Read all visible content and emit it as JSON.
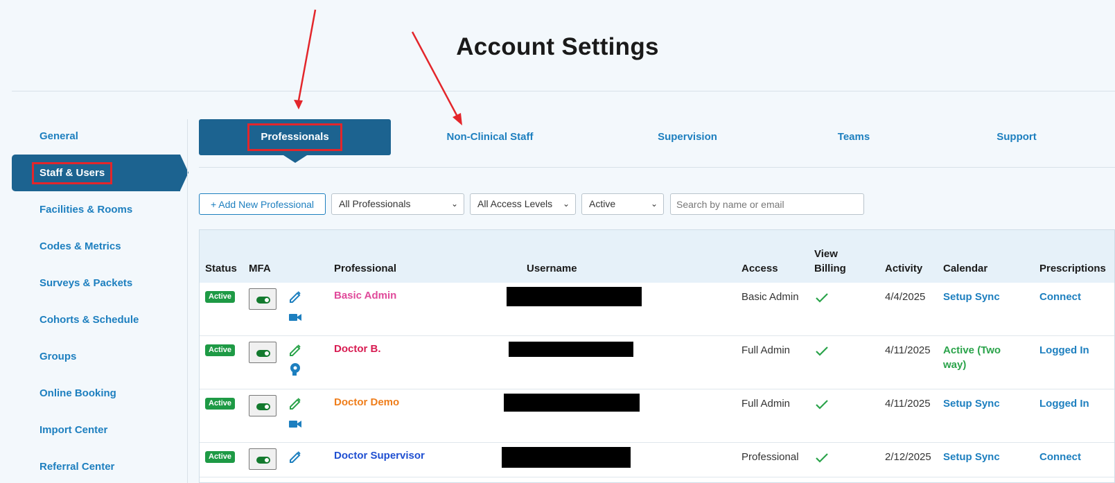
{
  "page": {
    "title": "Account Settings"
  },
  "sidebar": {
    "items": [
      {
        "label": "General"
      },
      {
        "label": "Staff & Users",
        "active": true
      },
      {
        "label": "Facilities & Rooms"
      },
      {
        "label": "Codes & Metrics"
      },
      {
        "label": "Surveys & Packets"
      },
      {
        "label": "Cohorts & Schedule"
      },
      {
        "label": "Groups"
      },
      {
        "label": "Online Booking"
      },
      {
        "label": "Import Center"
      },
      {
        "label": "Referral Center"
      }
    ]
  },
  "tabs": [
    {
      "label": "Professionals",
      "active": true
    },
    {
      "label": "Non-Clinical Staff"
    },
    {
      "label": "Supervision"
    },
    {
      "label": "Teams"
    },
    {
      "label": "Support"
    }
  ],
  "filters": {
    "add_button": "+ Add New Professional",
    "professionals_select": "All Professionals",
    "access_select": "All Access Levels",
    "status_select": "Active",
    "search_placeholder": "Search by name or email"
  },
  "table": {
    "headers": {
      "status": "Status",
      "mfa": "MFA",
      "professional": "Professional",
      "username": "Username",
      "access": "Access",
      "view_billing_1": "View",
      "view_billing_2": "Billing",
      "activity": "Activity",
      "calendar": "Calendar",
      "prescriptions": "Prescriptions"
    },
    "rows": [
      {
        "status": "Active",
        "name": "Basic Admin",
        "name_color": "#e0499a",
        "access": "Basic Admin",
        "activity": "4/4/2025",
        "calendar": "Setup Sync",
        "calendar_type": "link",
        "prescriptions": "Connect",
        "second_icon": "video-icon"
      },
      {
        "status": "Active",
        "name": "Doctor B.",
        "name_color": "#d81b51",
        "access": "Full Admin",
        "activity": "4/11/2025",
        "calendar": "Active (Two way)",
        "calendar_type": "green",
        "prescriptions": "Logged In",
        "second_icon": "head-gear-icon"
      },
      {
        "status": "Active",
        "name": "Doctor Demo",
        "name_color": "#ef7d1a",
        "access": "Full Admin",
        "activity": "4/11/2025",
        "calendar": "Setup Sync",
        "calendar_type": "link",
        "prescriptions": "Logged In",
        "second_icon": "video-icon"
      },
      {
        "status": "Active",
        "name": "Doctor Supervisor",
        "name_color": "#1f4fd1",
        "access": "Professional",
        "activity": "2/12/2025",
        "calendar": "Setup Sync",
        "calendar_type": "link",
        "prescriptions": "Connect",
        "second_icon": ""
      }
    ]
  },
  "colors": {
    "primary": "#1c6390",
    "link": "#1d7fbf",
    "active_badge": "#1e9a45",
    "annotation_red": "#e3262b"
  }
}
